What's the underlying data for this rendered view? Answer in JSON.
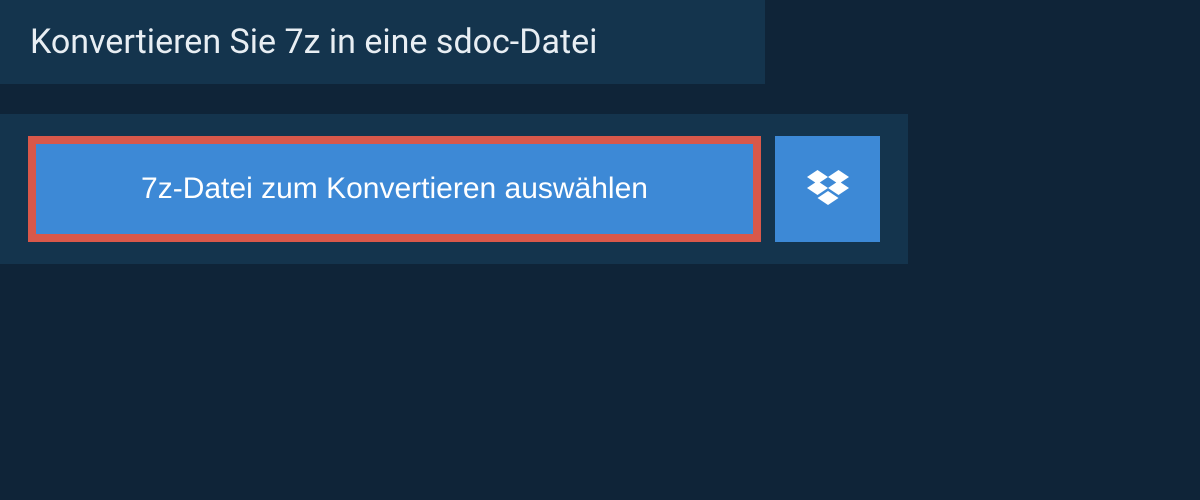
{
  "header": {
    "title": "Konvertieren Sie 7z in eine sdoc-Datei"
  },
  "actions": {
    "select_file_label": "7z-Datei zum Konvertieren auswählen",
    "dropbox_icon": "dropbox-icon"
  },
  "colors": {
    "background": "#0f2438",
    "panel": "#14344d",
    "button": "#3d89d6",
    "highlight_border": "#d9584a",
    "text_light": "#e8eef3",
    "text_white": "#ffffff"
  }
}
